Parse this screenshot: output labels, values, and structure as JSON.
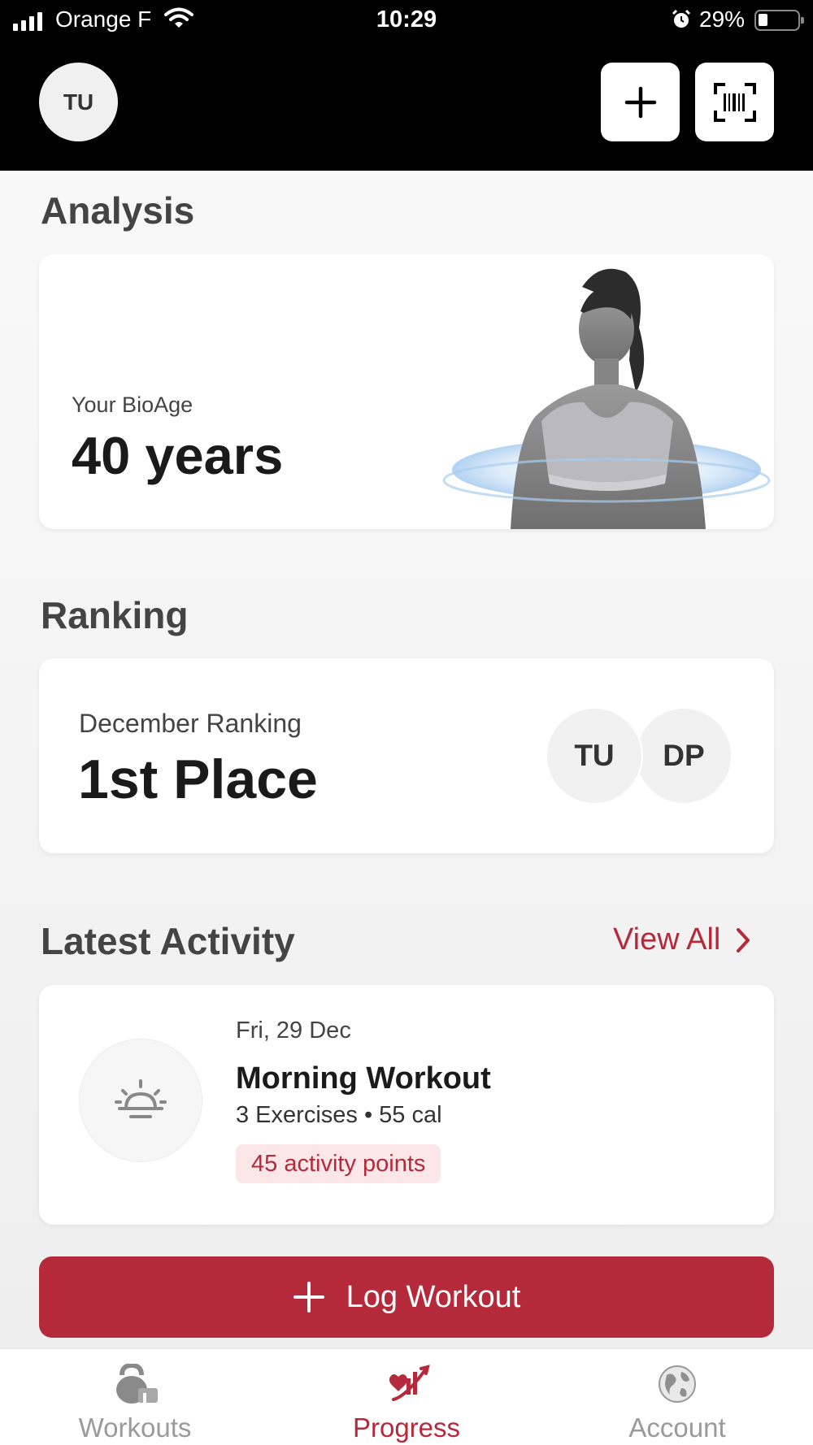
{
  "status_bar": {
    "carrier": "Orange F",
    "time": "10:29",
    "battery": "29%",
    "battery_level": 0.29
  },
  "header": {
    "user_initials": "TU",
    "add_icon": "plus-icon",
    "scan_icon": "barcode-scan-icon"
  },
  "analysis": {
    "heading": "Analysis",
    "bioage_label": "Your BioAge",
    "bioage_value": "40 years"
  },
  "ranking": {
    "heading": "Ranking",
    "label": "December Ranking",
    "value": "1st Place",
    "participants": [
      "TU",
      "DP"
    ]
  },
  "latest_activity": {
    "heading": "Latest Activity",
    "view_all": "View All",
    "item": {
      "date": "Fri, 29 Dec",
      "title": "Morning Workout",
      "meta": "3 Exercises • 55 cal",
      "badge": "45 activity points",
      "icon": "sunrise-icon"
    }
  },
  "log_button": {
    "label": "Log Workout"
  },
  "bottom_nav": {
    "items": [
      {
        "label": "Workouts",
        "icon": "kettlebell-icon",
        "active": false
      },
      {
        "label": "Progress",
        "icon": "progress-chart-icon",
        "active": true
      },
      {
        "label": "Account",
        "icon": "globe-icon",
        "active": false
      }
    ]
  },
  "colors": {
    "accent": "#b52a3a",
    "badge_bg": "#fbe6e8",
    "topbar": "#000000"
  }
}
